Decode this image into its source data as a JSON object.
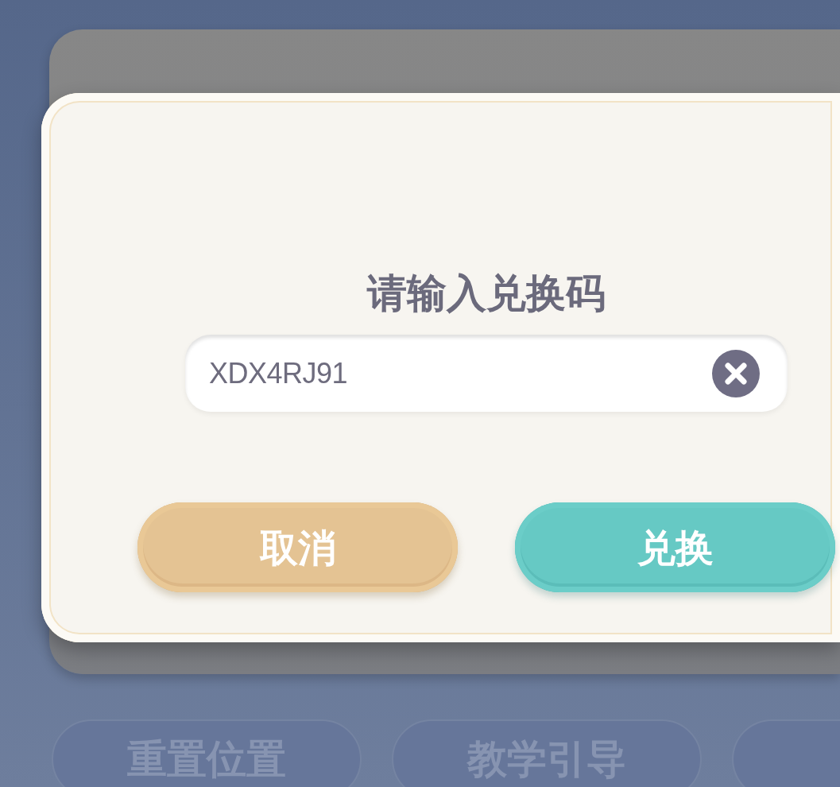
{
  "background": {
    "bottom_buttons": [
      {
        "kind": "text",
        "label": "重置位置"
      },
      {
        "kind": "text",
        "label": "教学引导"
      },
      {
        "kind": "cut"
      }
    ]
  },
  "dialog": {
    "title": "请输入兑换码",
    "code_field": {
      "value": "XDX4RJ91"
    },
    "buttons": [
      {
        "kind": "cancel",
        "label": "取消"
      },
      {
        "kind": "confirm",
        "label": "兑换"
      }
    ]
  }
}
